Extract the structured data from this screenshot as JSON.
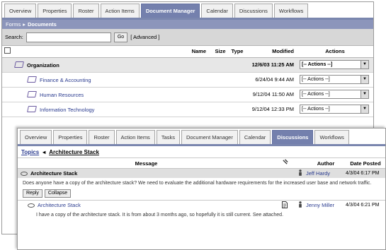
{
  "back_window": {
    "tabs": [
      "Overview",
      "Properties",
      "Roster",
      "Action Items",
      "Document Manager",
      "Calendar",
      "Discussions",
      "Workflows"
    ],
    "active_tab": 4,
    "breadcrumb": {
      "root": "Forms",
      "separator": "▸",
      "current": "Documents"
    },
    "search": {
      "label": "Search:",
      "value": "",
      "go": "Go",
      "advanced": "[ Advanced ]"
    },
    "columns": {
      "name": "Name",
      "size": "Size",
      "type": "Type",
      "modified": "Modified",
      "actions": "Actions"
    },
    "rows": [
      {
        "name": "Organization",
        "modified": "12/6/03 11:25 AM",
        "action": "[-- Actions --]"
      },
      {
        "name": "Finance & Accounting",
        "modified": "6/24/04 9:44 AM",
        "action": "[-- Actions --]"
      },
      {
        "name": "Human Resources",
        "modified": "9/12/04 11:50 AM",
        "action": "[-- Actions --]"
      },
      {
        "name": "Information Technology",
        "modified": "9/12/04 12:33 PM",
        "action": "[-- Actions --]"
      }
    ]
  },
  "front_window": {
    "tabs": [
      "Overview",
      "Properties",
      "Roster",
      "Action Items",
      "Tasks",
      "Document Manager",
      "Calendar",
      "Discussions",
      "Workflows"
    ],
    "active_tab": 7,
    "breadcrumb": {
      "root": "Topics",
      "separator": "◂",
      "current": "Architecture Stack"
    },
    "columns": {
      "message": "Message",
      "author": "Author",
      "date": "Date Posted"
    },
    "topic": {
      "title": "Architecture Stack",
      "author": "Jeff Hardy",
      "date": "4/3/04 6:17 PM",
      "body": "Does anyone have a copy of the architecture stack? We need to evaluate the additional hardware requirements for the increased user base and network traffic.",
      "buttons": {
        "reply": "Reply",
        "collapse": "Collapse"
      }
    },
    "reply": {
      "title": "Architecture Stack",
      "author": "Jenny Miller",
      "date": "4/3/04 6:21 PM",
      "body": "I have a copy of the architecture stack. It is from about 3 months ago, so hopefully it is still current. See attached."
    }
  }
}
